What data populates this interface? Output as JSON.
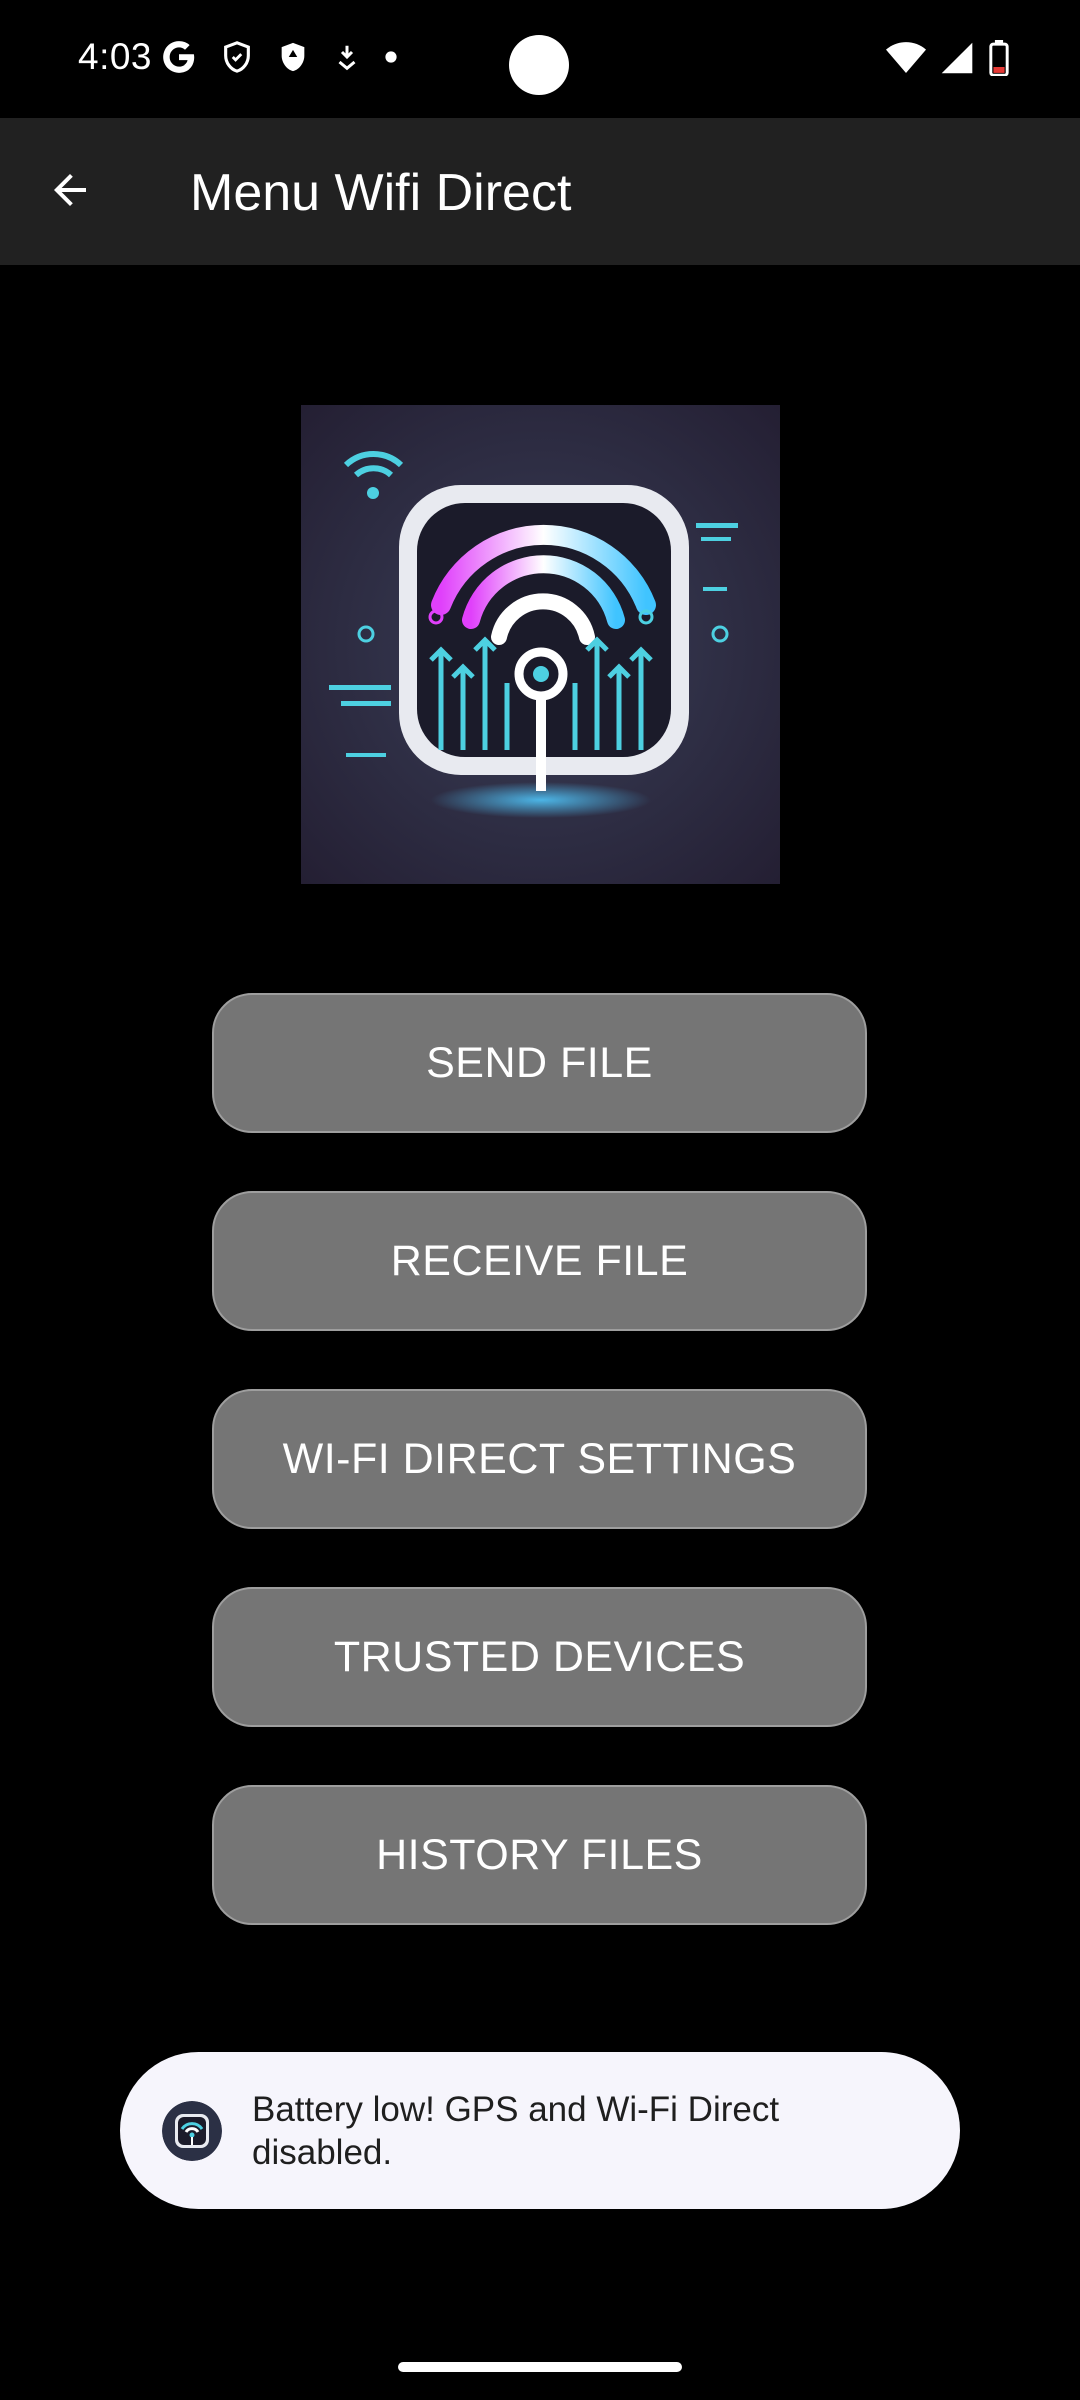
{
  "status_bar": {
    "time": "4:03",
    "left_icons": [
      "google-icon",
      "shield-icon",
      "shield-filled-icon",
      "download-icon",
      "dot-icon"
    ],
    "right_icons": [
      "wifi-icon",
      "signal-icon",
      "battery-low-icon"
    ]
  },
  "app_bar": {
    "title": "Menu Wifi Direct",
    "back_icon": "arrow-back-icon"
  },
  "logo": {
    "icon": "wifi-direct-app-logo"
  },
  "menu": {
    "buttons": [
      {
        "label": "SEND FILE"
      },
      {
        "label": "RECEIVE FILE"
      },
      {
        "label": "WI-FI DIRECT SETTINGS"
      },
      {
        "label": "TRUSTED DEVICES"
      },
      {
        "label": "HISTORY FILES"
      }
    ]
  },
  "toast": {
    "message": "Battery low! GPS and Wi-Fi Direct disabled.",
    "icon": "app-icon"
  },
  "colors": {
    "background": "#000000",
    "app_bar": "#212121",
    "button_fill": "#757575",
    "button_border": "#9e9e9e",
    "toast_background": "#f6f5fc",
    "battery_low": "#e53935"
  }
}
